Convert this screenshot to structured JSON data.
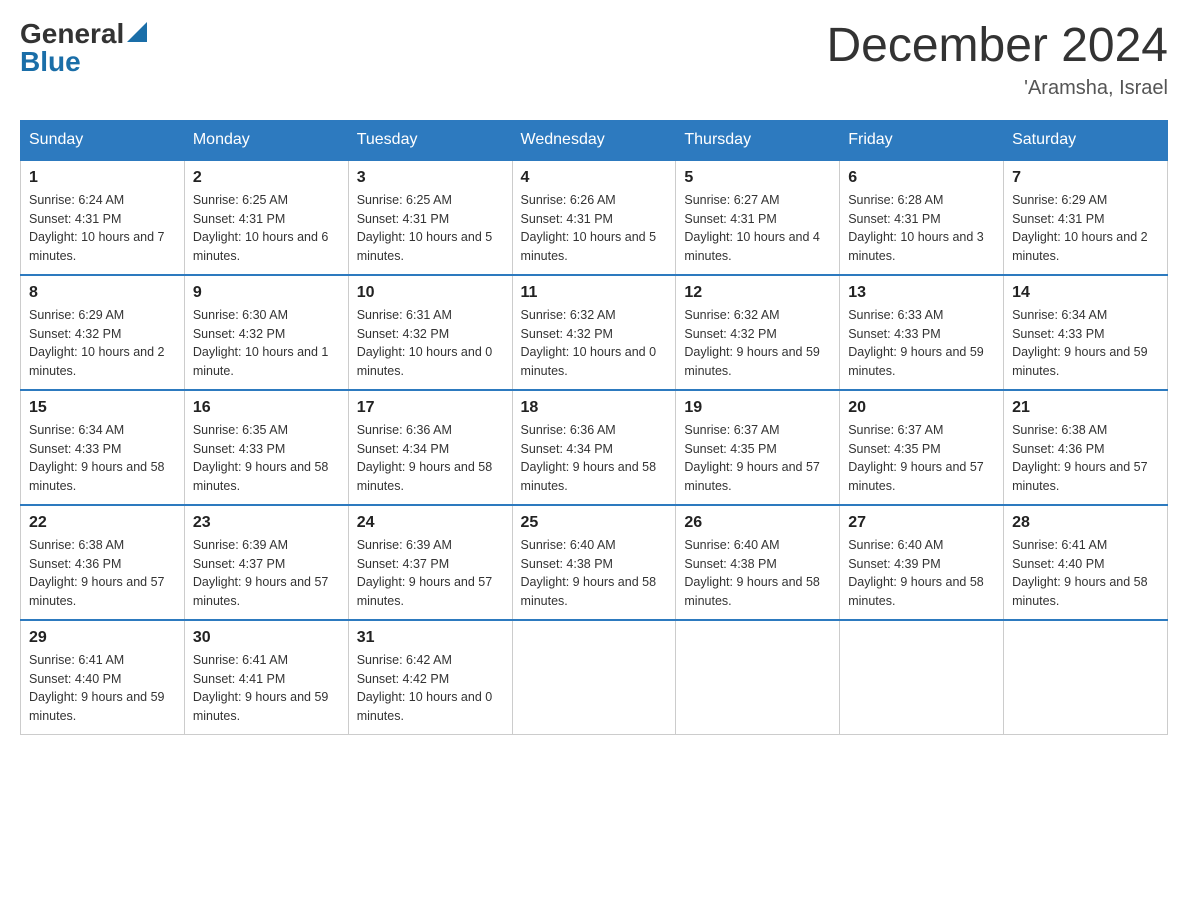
{
  "header": {
    "logo_general": "General",
    "logo_blue": "Blue",
    "month_title": "December 2024",
    "location": "'Aramsha, Israel"
  },
  "days_of_week": [
    "Sunday",
    "Monday",
    "Tuesday",
    "Wednesday",
    "Thursday",
    "Friday",
    "Saturday"
  ],
  "weeks": [
    [
      {
        "day": "1",
        "sunrise": "6:24 AM",
        "sunset": "4:31 PM",
        "daylight": "10 hours and 7 minutes."
      },
      {
        "day": "2",
        "sunrise": "6:25 AM",
        "sunset": "4:31 PM",
        "daylight": "10 hours and 6 minutes."
      },
      {
        "day": "3",
        "sunrise": "6:25 AM",
        "sunset": "4:31 PM",
        "daylight": "10 hours and 5 minutes."
      },
      {
        "day": "4",
        "sunrise": "6:26 AM",
        "sunset": "4:31 PM",
        "daylight": "10 hours and 5 minutes."
      },
      {
        "day": "5",
        "sunrise": "6:27 AM",
        "sunset": "4:31 PM",
        "daylight": "10 hours and 4 minutes."
      },
      {
        "day": "6",
        "sunrise": "6:28 AM",
        "sunset": "4:31 PM",
        "daylight": "10 hours and 3 minutes."
      },
      {
        "day": "7",
        "sunrise": "6:29 AM",
        "sunset": "4:31 PM",
        "daylight": "10 hours and 2 minutes."
      }
    ],
    [
      {
        "day": "8",
        "sunrise": "6:29 AM",
        "sunset": "4:32 PM",
        "daylight": "10 hours and 2 minutes."
      },
      {
        "day": "9",
        "sunrise": "6:30 AM",
        "sunset": "4:32 PM",
        "daylight": "10 hours and 1 minute."
      },
      {
        "day": "10",
        "sunrise": "6:31 AM",
        "sunset": "4:32 PM",
        "daylight": "10 hours and 0 minutes."
      },
      {
        "day": "11",
        "sunrise": "6:32 AM",
        "sunset": "4:32 PM",
        "daylight": "10 hours and 0 minutes."
      },
      {
        "day": "12",
        "sunrise": "6:32 AM",
        "sunset": "4:32 PM",
        "daylight": "9 hours and 59 minutes."
      },
      {
        "day": "13",
        "sunrise": "6:33 AM",
        "sunset": "4:33 PM",
        "daylight": "9 hours and 59 minutes."
      },
      {
        "day": "14",
        "sunrise": "6:34 AM",
        "sunset": "4:33 PM",
        "daylight": "9 hours and 59 minutes."
      }
    ],
    [
      {
        "day": "15",
        "sunrise": "6:34 AM",
        "sunset": "4:33 PM",
        "daylight": "9 hours and 58 minutes."
      },
      {
        "day": "16",
        "sunrise": "6:35 AM",
        "sunset": "4:33 PM",
        "daylight": "9 hours and 58 minutes."
      },
      {
        "day": "17",
        "sunrise": "6:36 AM",
        "sunset": "4:34 PM",
        "daylight": "9 hours and 58 minutes."
      },
      {
        "day": "18",
        "sunrise": "6:36 AM",
        "sunset": "4:34 PM",
        "daylight": "9 hours and 58 minutes."
      },
      {
        "day": "19",
        "sunrise": "6:37 AM",
        "sunset": "4:35 PM",
        "daylight": "9 hours and 57 minutes."
      },
      {
        "day": "20",
        "sunrise": "6:37 AM",
        "sunset": "4:35 PM",
        "daylight": "9 hours and 57 minutes."
      },
      {
        "day": "21",
        "sunrise": "6:38 AM",
        "sunset": "4:36 PM",
        "daylight": "9 hours and 57 minutes."
      }
    ],
    [
      {
        "day": "22",
        "sunrise": "6:38 AM",
        "sunset": "4:36 PM",
        "daylight": "9 hours and 57 minutes."
      },
      {
        "day": "23",
        "sunrise": "6:39 AM",
        "sunset": "4:37 PM",
        "daylight": "9 hours and 57 minutes."
      },
      {
        "day": "24",
        "sunrise": "6:39 AM",
        "sunset": "4:37 PM",
        "daylight": "9 hours and 57 minutes."
      },
      {
        "day": "25",
        "sunrise": "6:40 AM",
        "sunset": "4:38 PM",
        "daylight": "9 hours and 58 minutes."
      },
      {
        "day": "26",
        "sunrise": "6:40 AM",
        "sunset": "4:38 PM",
        "daylight": "9 hours and 58 minutes."
      },
      {
        "day": "27",
        "sunrise": "6:40 AM",
        "sunset": "4:39 PM",
        "daylight": "9 hours and 58 minutes."
      },
      {
        "day": "28",
        "sunrise": "6:41 AM",
        "sunset": "4:40 PM",
        "daylight": "9 hours and 58 minutes."
      }
    ],
    [
      {
        "day": "29",
        "sunrise": "6:41 AM",
        "sunset": "4:40 PM",
        "daylight": "9 hours and 59 minutes."
      },
      {
        "day": "30",
        "sunrise": "6:41 AM",
        "sunset": "4:41 PM",
        "daylight": "9 hours and 59 minutes."
      },
      {
        "day": "31",
        "sunrise": "6:42 AM",
        "sunset": "4:42 PM",
        "daylight": "10 hours and 0 minutes."
      },
      null,
      null,
      null,
      null
    ]
  ]
}
